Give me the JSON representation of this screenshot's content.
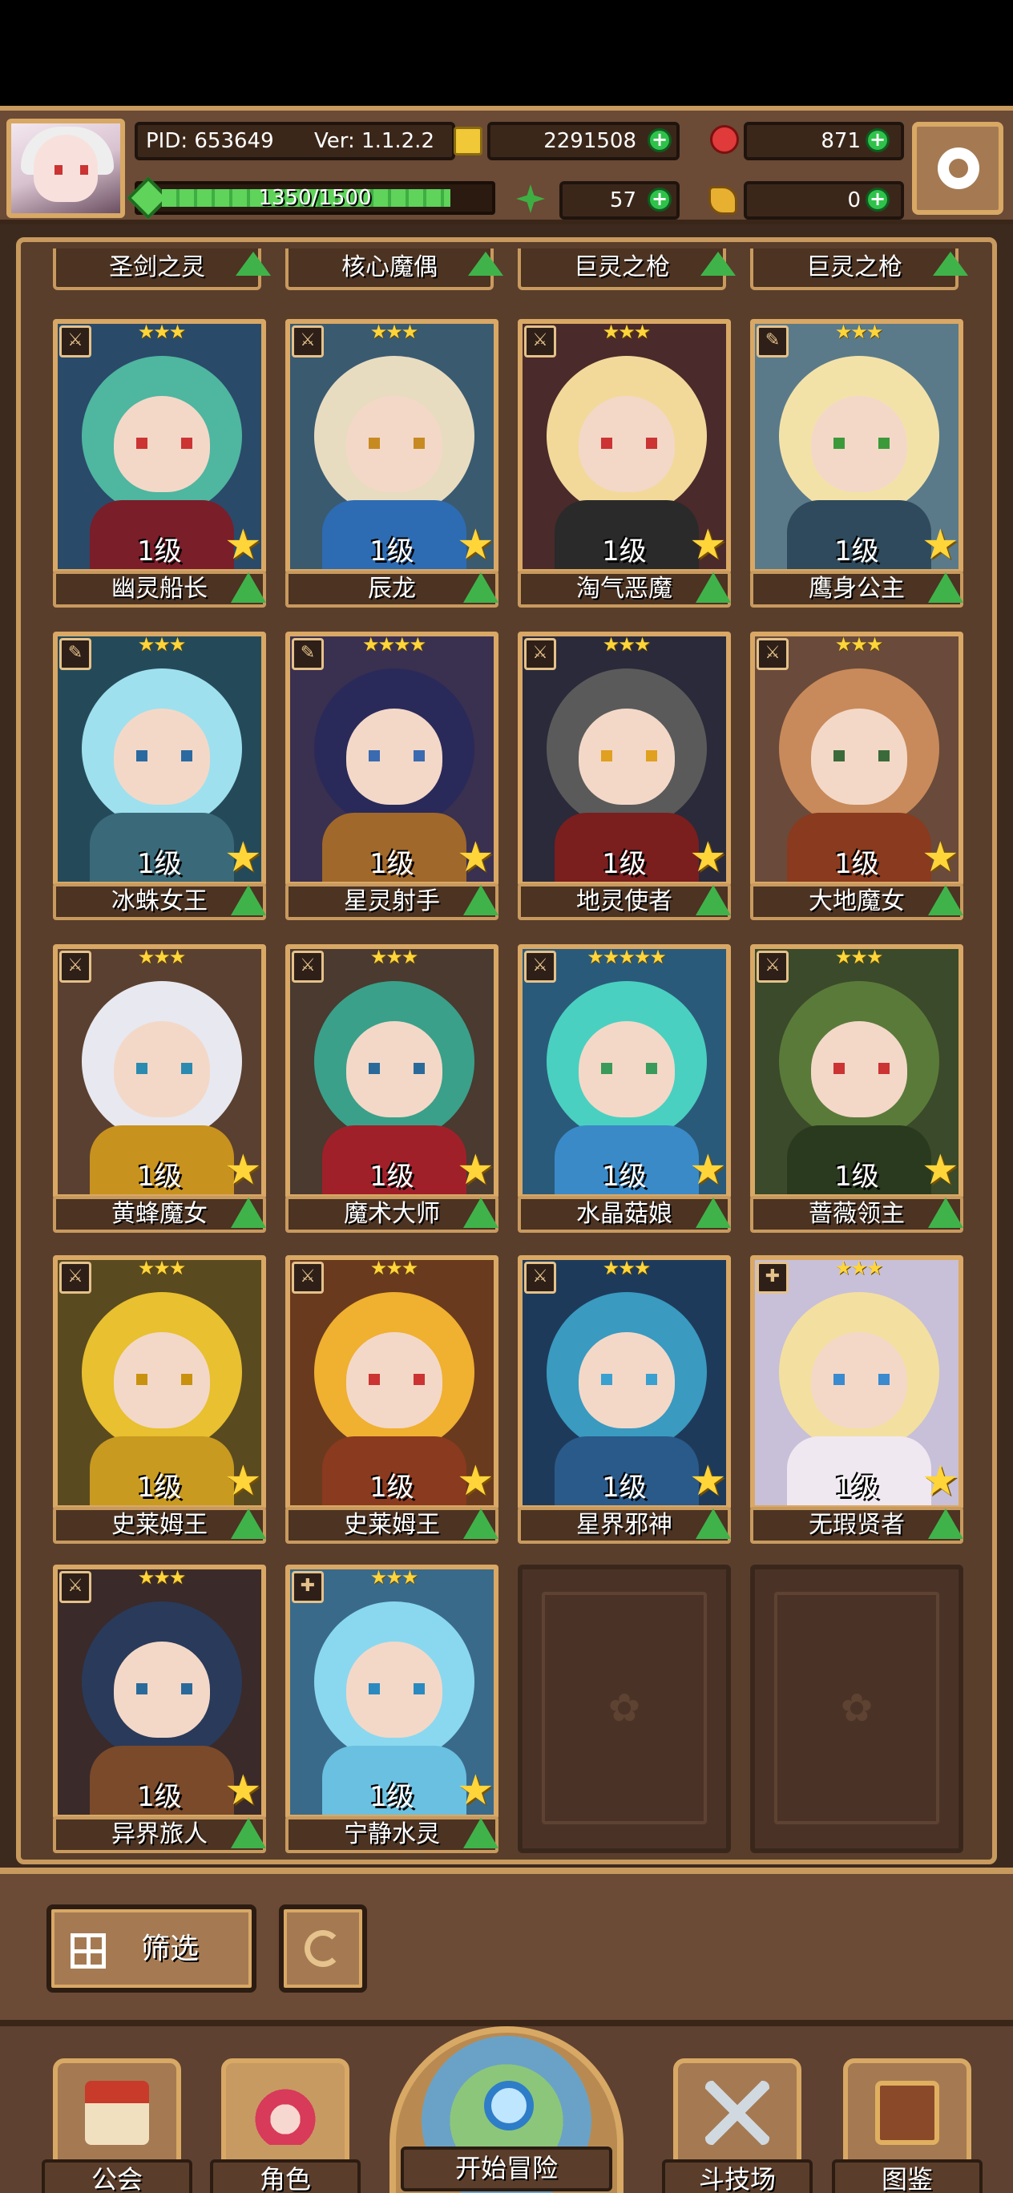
{
  "player": {
    "pid": "PID: 653649",
    "version": "Ver: 1.1.2.2",
    "xp": "1350/1500",
    "xp_progress": 0.9
  },
  "resources": {
    "gold": "2291508",
    "gems": "871",
    "clover": "57",
    "keys": "0"
  },
  "top_row": [
    {
      "name": "圣剑之灵"
    },
    {
      "name": "核心魔偶"
    },
    {
      "name": "巨灵之枪"
    },
    {
      "name": "巨灵之枪"
    }
  ],
  "cards": [
    {
      "name": "幽灵船长",
      "level": "1级",
      "stars": "★★★",
      "type": "sword",
      "hair": "#4fb6a0",
      "outfit": "#7a1e2a",
      "bg": "#2a4a6a",
      "eye": "#c33"
    },
    {
      "name": "辰龙",
      "level": "1级",
      "stars": "★★★",
      "type": "sword",
      "hair": "#e8dcc0",
      "outfit": "#2d6cb3",
      "bg": "#3a5a70",
      "eye": "#c78a20"
    },
    {
      "name": "淘气恶魔",
      "level": "1级",
      "stars": "★★★",
      "type": "sword",
      "hair": "#f2d99a",
      "outfit": "#2a2a2a",
      "bg": "#4a2a2a",
      "eye": "#c33"
    },
    {
      "name": "鹰身公主",
      "level": "1级",
      "stars": "★★★",
      "type": "staff",
      "hair": "#f3e2a8",
      "outfit": "#2f4a5c",
      "bg": "#5a7a8a",
      "eye": "#3a9a3a"
    },
    {
      "name": "冰蛛女王",
      "level": "1级",
      "stars": "★★★",
      "type": "staff",
      "hair": "#9fe0ee",
      "outfit": "#3a6a7a",
      "bg": "#244a5a",
      "eye": "#2a6aa0"
    },
    {
      "name": "星灵射手",
      "level": "1级",
      "stars": "★★★★",
      "type": "staff",
      "hair": "#2a2a5a",
      "outfit": "#a0682a",
      "bg": "#3a3050",
      "eye": "#3a6ab0"
    },
    {
      "name": "地灵使者",
      "level": "1级",
      "stars": "★★★",
      "type": "sword",
      "hair": "#5a5a5a",
      "outfit": "#7a1e1e",
      "bg": "#2a2a3a",
      "eye": "#e0a020"
    },
    {
      "name": "大地魔女",
      "level": "1级",
      "stars": "★★★",
      "type": "sword",
      "hair": "#c88a5a",
      "outfit": "#8a3a1e",
      "bg": "#6a4a3a",
      "eye": "#3a6a3a"
    },
    {
      "name": "黄蜂魔女",
      "level": "1级",
      "stars": "★★★",
      "type": "sword",
      "hair": "#e8e8f0",
      "outfit": "#c8921e",
      "bg": "#5a4030",
      "eye": "#2a8ab0"
    },
    {
      "name": "魔术大师",
      "level": "1级",
      "stars": "★★★",
      "type": "sword",
      "hair": "#3aa08a",
      "outfit": "#a0202a",
      "bg": "#4a3a30",
      "eye": "#2a6a9a"
    },
    {
      "name": "水晶菇娘",
      "level": "1级",
      "stars": "★★★★★",
      "type": "sword",
      "hair": "#4ad0c0",
      "outfit": "#3a8ac8",
      "bg": "#2a5a7a",
      "eye": "#3a9a5a"
    },
    {
      "name": "蔷薇领主",
      "level": "1级",
      "stars": "★★★",
      "type": "sword",
      "hair": "#5a7a3a",
      "outfit": "#2a3a1e",
      "bg": "#3a4a2a",
      "eye": "#c33"
    },
    {
      "name": "史莱姆王",
      "level": "1级",
      "stars": "★★★",
      "type": "sword",
      "hair": "#e8c030",
      "outfit": "#c89a20",
      "bg": "#5a4a20",
      "eye": "#c8920e"
    },
    {
      "name": "史莱姆王",
      "level": "1级",
      "stars": "★★★",
      "type": "sword",
      "hair": "#f0b030",
      "outfit": "#8a3a1e",
      "bg": "#6a3a1e",
      "eye": "#c33"
    },
    {
      "name": "星界邪神",
      "level": "1级",
      "stars": "★★★",
      "type": "sword",
      "hair": "#3a9ac0",
      "outfit": "#2a5a8a",
      "bg": "#1e3a5a",
      "eye": "#3aa0d0"
    },
    {
      "name": "无瑕贤者",
      "level": "1级",
      "stars": "★★★",
      "type": "cross",
      "hair": "#f3e0a0",
      "outfit": "#f0e8f0",
      "bg": "#c8c0d8",
      "eye": "#3a8ad0"
    },
    {
      "name": "异界旅人",
      "level": "1级",
      "stars": "★★★",
      "type": "sword",
      "hair": "#2a3a5a",
      "outfit": "#7a4a2a",
      "bg": "#3a2a2a",
      "eye": "#2a6a9a"
    },
    {
      "name": "宁静水灵",
      "level": "1级",
      "stars": "★★★",
      "type": "cross",
      "hair": "#8ad8f0",
      "outfit": "#6ac0e0",
      "bg": "#3a6a8a",
      "eye": "#2a8ac0"
    }
  ],
  "buttons": {
    "filter": "筛选"
  },
  "nav": {
    "guild": "公会",
    "character": "角色",
    "adventure": "开始冒险",
    "arena": "斗技场",
    "codex": "图鉴"
  },
  "colors": {
    "frame": "#c89a5e",
    "panel": "#5a3e2c",
    "plus": "#2fc24a",
    "star": "#ffd53a"
  }
}
